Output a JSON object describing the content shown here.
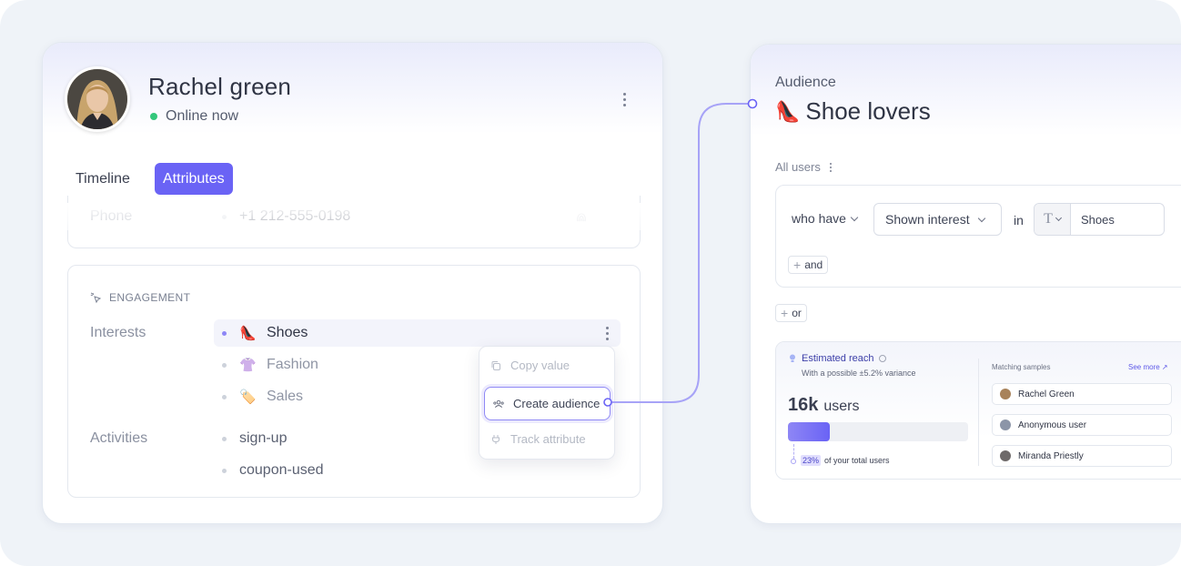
{
  "profile": {
    "name": "Rachel green",
    "status": "Online now",
    "tabs": [
      {
        "label": "Timeline",
        "active": false
      },
      {
        "label": "Attributes",
        "active": true
      }
    ],
    "phone": {
      "label": "Phone",
      "value": "+1 212-555-0198"
    },
    "engagement": {
      "section_title": "ENGAGEMENT",
      "interests_label": "Interests",
      "interests": [
        {
          "emoji": "👠",
          "label": "Shoes",
          "active": true
        },
        {
          "emoji": "👚",
          "label": "Fashion",
          "active": false
        },
        {
          "emoji": "🏷️",
          "label": "Sales",
          "active": false
        }
      ],
      "activities_label": "Activities",
      "activities": [
        "sign-up",
        "coupon-used"
      ]
    },
    "context_menu": {
      "items": [
        "Copy value",
        "Create audience",
        "Track attribute"
      ],
      "highlighted": "Create audience"
    }
  },
  "audience": {
    "title": "Audience",
    "emoji": "👠",
    "name": "Shoe lovers",
    "scope": "All users",
    "rule": {
      "prefix": "who have",
      "condition": "Shown interest",
      "in_label": "in",
      "type_icon": "T",
      "value": "Shoes",
      "and_label": "and",
      "or_label": "or"
    },
    "reach": {
      "title": "Estimated reach",
      "variance": "With a possible ±5.2% variance",
      "count": "16k",
      "count_unit": "users",
      "percent": "23%",
      "percent_text": "of your total users",
      "fill": 0.23
    },
    "samples": {
      "title": "Matching samples",
      "see_more": "See more ↗",
      "items": [
        "Rachel Green",
        "Anonymous user",
        "Miranda Priestly"
      ]
    }
  },
  "colors": {
    "accent": "#6a63f5",
    "online": "#34c77b",
    "connector": "#a7a3f7"
  }
}
